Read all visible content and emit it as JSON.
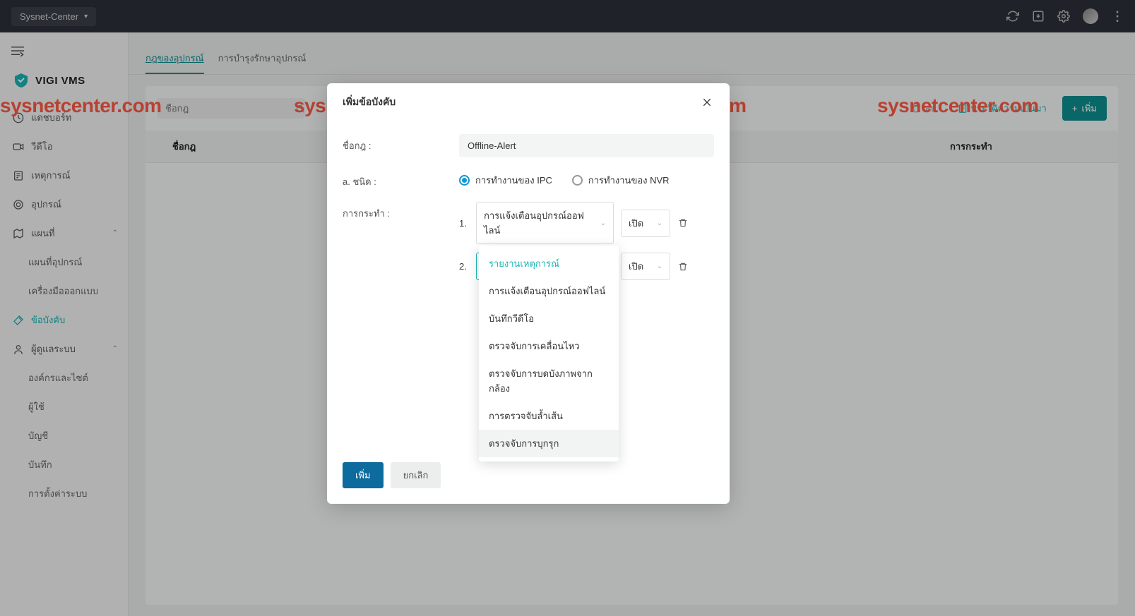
{
  "topbar": {
    "site_name": "Sysnet-Center"
  },
  "logo": {
    "text": "VIGI VMS"
  },
  "sidebar": {
    "items": [
      {
        "label": "แดชบอร์ท"
      },
      {
        "label": "วีดีโอ"
      },
      {
        "label": "เหตุการณ์"
      },
      {
        "label": "อุปกรณ์"
      },
      {
        "label": "แผนที่"
      },
      {
        "label": "แผนที่อุปกรณ์"
      },
      {
        "label": "เครื่องมือออกแบบ"
      },
      {
        "label": "ข้อบังคับ"
      },
      {
        "label": "ผู้ดูแลระบบ"
      },
      {
        "label": "องค์กรและไซต์"
      },
      {
        "label": "ผู้ใช้"
      },
      {
        "label": "บัญชี"
      },
      {
        "label": "บันทึก"
      },
      {
        "label": "การตั้งค่าระบบ"
      }
    ]
  },
  "tabs": {
    "t0": "กฎของอุปกรณ์",
    "t1": "การบำรุงรักษาอุปกรณ์"
  },
  "toolbar": {
    "search_placeholder": "ชื่อกฎ",
    "delete_label": "ลบ",
    "history_label": "ประวัติความเป็นมา",
    "add_label": "เพิ่ม"
  },
  "table": {
    "col_name": "ชื่อกฎ",
    "col_action": "การกระทำ"
  },
  "modal": {
    "title": "เพิ่มข้อบังคับ",
    "label_name": "ชื่อกฎ :",
    "name_value": "Offline-Alert",
    "label_type": "a. ชนิด :",
    "radio_ipc": "การทำงานของ IPC",
    "radio_nvr": "การทำงานของ NVR",
    "label_action": "การกระทำ :",
    "row1": {
      "num": "1.",
      "sel": "การแจ้งเตือนอุปกรณ์ออฟไลน์",
      "state": "เปิด"
    },
    "row2": {
      "num": "2.",
      "placeholder": "รายงานเหตุการณ์",
      "state": "เปิด"
    },
    "btn_add": "เพิ่ม",
    "btn_cancel": "ยกเลิก"
  },
  "dropdown": {
    "items": [
      "รายงานเหตุการณ์",
      "การแจ้งเตือนอุปกรณ์ออฟไลน์",
      "บันทึกวีดีโอ",
      "ตรวจจับการเคลื่อนไหว",
      "ตรวจจับการบดบังภาพจากกล้อง",
      "การตรวจจับล้ำเส้น",
      "ตรวจจับการบุกรุก"
    ]
  },
  "watermark": "sysnetcenter.com"
}
